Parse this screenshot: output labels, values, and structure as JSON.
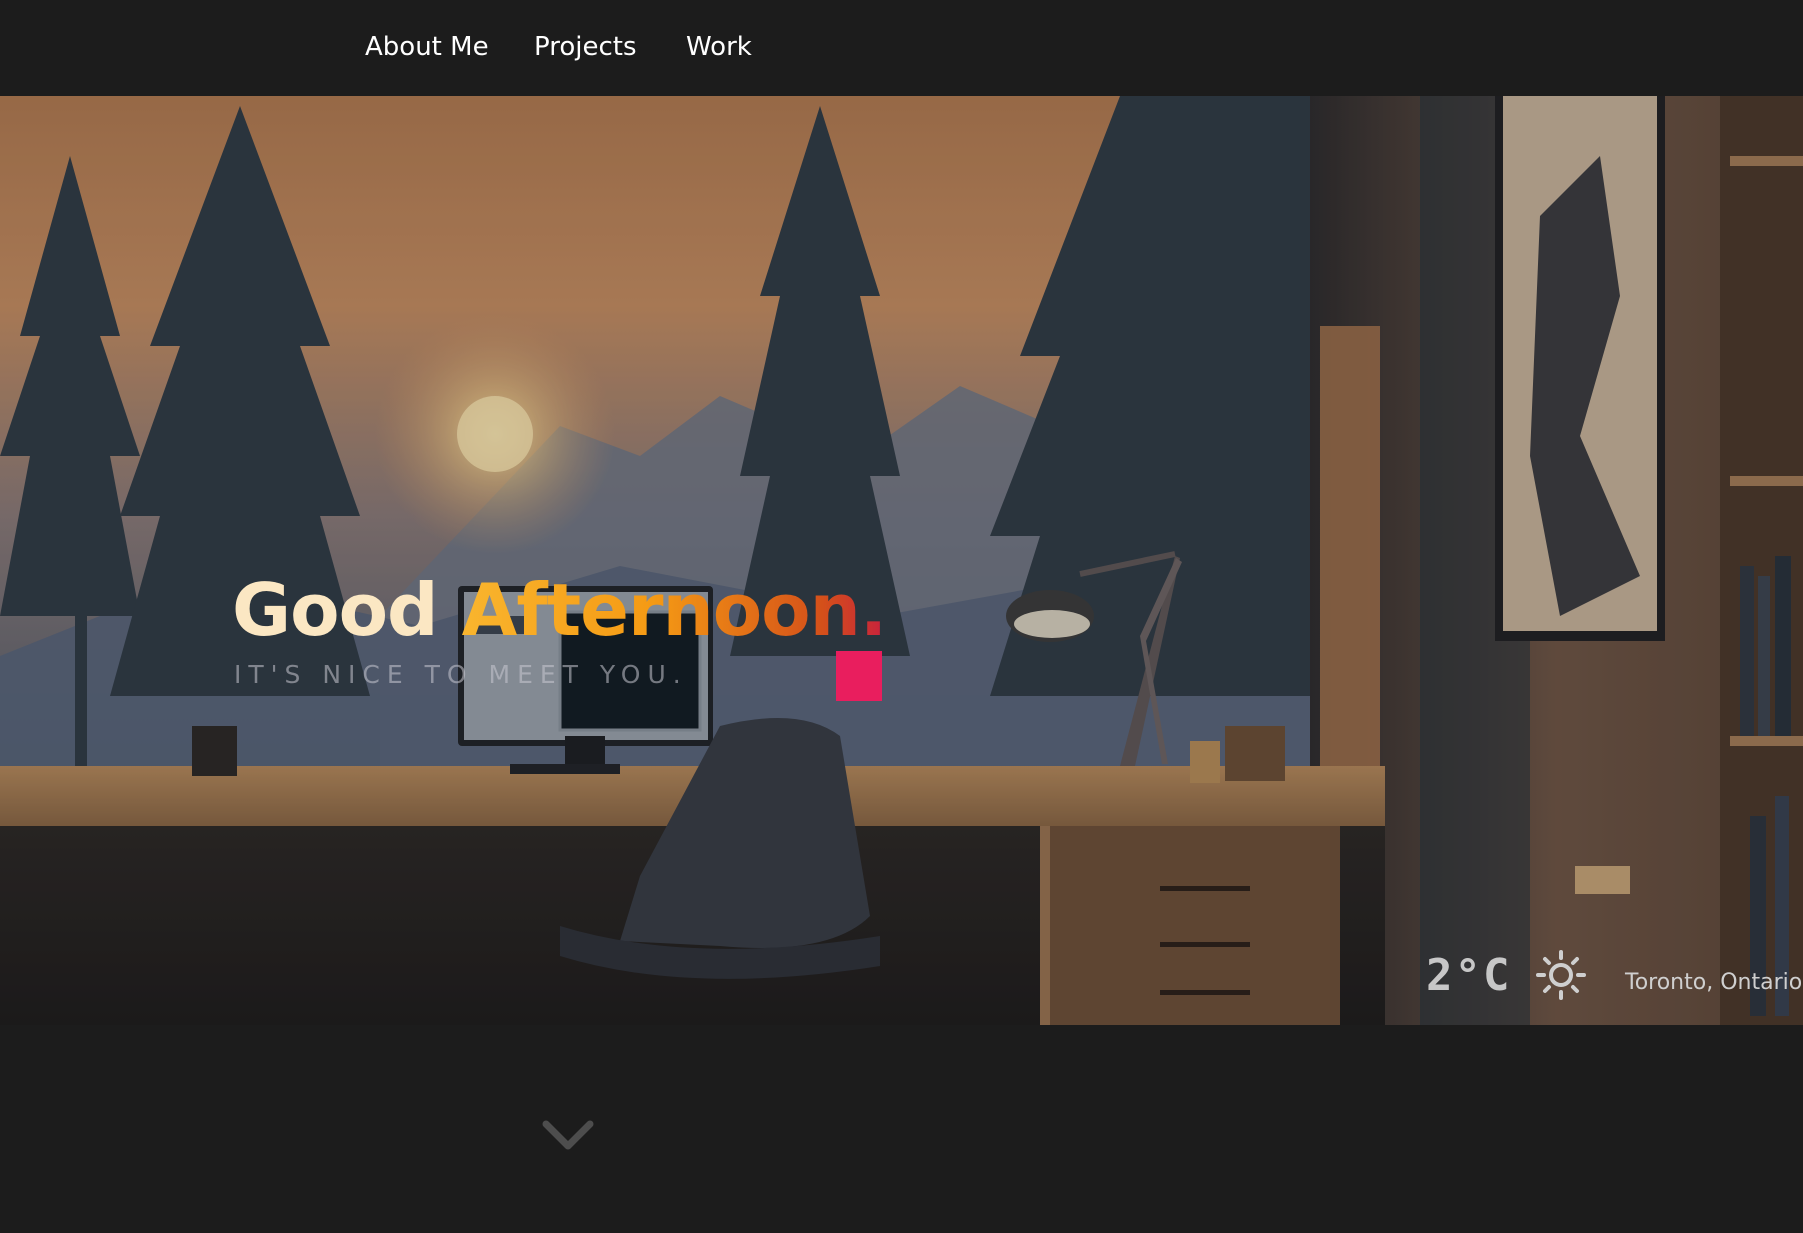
{
  "nav": {
    "items": [
      {
        "label": "About Me"
      },
      {
        "label": "Projects"
      },
      {
        "label": "Work"
      }
    ]
  },
  "hero": {
    "greeting_word1": "Good",
    "greeting_word2": "Afternoon.",
    "subtitle": "IT'S NICE TO MEET YOU.",
    "accent_color": "#e91e5e"
  },
  "weather": {
    "temperature": "2°C",
    "icon": "sun-icon",
    "location": "Toronto, Ontario"
  },
  "scroll": {
    "icon": "chevron-down-icon"
  }
}
